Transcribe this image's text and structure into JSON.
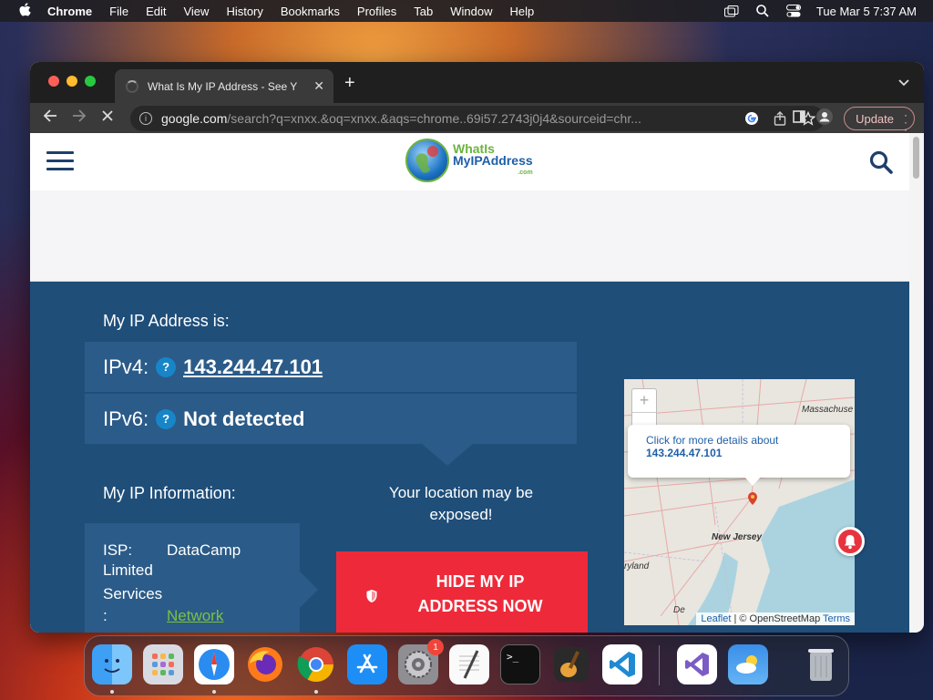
{
  "menubar": {
    "apple": "",
    "app_name": "Chrome",
    "items": [
      "File",
      "Edit",
      "View",
      "History",
      "Bookmarks",
      "Profiles",
      "Tab",
      "Window",
      "Help"
    ],
    "clock": "Tue Mar 5  7:37 AM"
  },
  "browser": {
    "tab_title": "What Is My IP Address - See Y",
    "tab_close": "✕",
    "new_tab": "+",
    "url_host": "google.com",
    "url_rest": "/search?q=xnxx.&oq=xnxx.&aqs=chrome..69i57.2743j0j4&sourceid=chr...",
    "update_label": "Update"
  },
  "site": {
    "logo_line1": "WhatIs",
    "logo_line2": "MyIPAddress",
    "logo_line3": ".com",
    "my_ip_label": "My IP Address is:",
    "ipv4_label": "IPv4:",
    "ipv4_value": "143.244.47.101",
    "ipv6_label": "IPv6:",
    "ipv6_value": "Not detected",
    "help_mark": "?",
    "info_label": "My IP Information:",
    "isp_key": "ISP:",
    "isp_value_line1": "DataCamp",
    "isp_value_line2": "Limited",
    "services_key_line1": "Services",
    "services_key_line2": ":",
    "services_value": "Network",
    "location_warning": "Your location may be exposed!",
    "hide_button_line1": "HIDE MY IP",
    "hide_button_line2": "ADDRESS NOW"
  },
  "map": {
    "zoom_in": "+",
    "zoom_out": "-",
    "popup_text": "Click for more details about",
    "popup_ip": "143.244.47.101",
    "label_massachusetts": "Massachuse",
    "label_new_jersey": "New Jersey",
    "label_maryland": "ryland",
    "label_delaware": "De",
    "attribution_leaflet": "Leaflet",
    "attribution_osm": "| © OpenStreetMap",
    "attribution_terms": "Terms"
  },
  "dock": {
    "apps": [
      "Finder",
      "Launchpad",
      "Safari",
      "Firefox",
      "Chrome",
      "App Store",
      "System Settings",
      "TextEdit",
      "Terminal",
      "GarageBand",
      "VS Code",
      "Visual Studio",
      "Weather",
      "Trash"
    ],
    "settings_badge": "1",
    "terminal_prompt": ">_"
  },
  "colors": {
    "hero_bg": "#1f4e79",
    "hero_row": "#2b5b88",
    "hide_button": "#ee2a3a",
    "link_green": "#7ac143",
    "chrome_dark": "#1f1f1f"
  }
}
